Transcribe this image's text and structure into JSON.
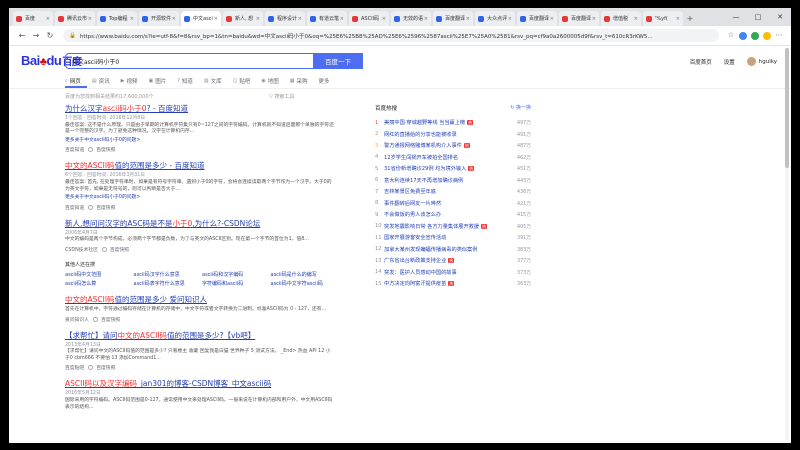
{
  "browser": {
    "tabs": [
      {
        "label": "百度",
        "icon": "red"
      },
      {
        "label": "腾讯云市",
        "icon": "red"
      },
      {
        "label": "Top编程",
        "icon": "blue"
      },
      {
        "label": "开源软件",
        "icon": "blue"
      },
      {
        "label": "中文asci",
        "icon": "blue",
        "active": true
      },
      {
        "label": "新人, 想",
        "icon": "red"
      },
      {
        "label": "程序设计",
        "icon": "blue"
      },
      {
        "label": "有道云笔",
        "icon": "blue"
      },
      {
        "label": "ASCII码",
        "icon": "red"
      },
      {
        "label": "无效的语",
        "icon": "blue"
      },
      {
        "label": "百度翻译",
        "icon": "blue"
      },
      {
        "label": "大众点评",
        "icon": "blue"
      },
      {
        "label": "百度翻译",
        "icon": "blue"
      },
      {
        "label": "百度翻译",
        "icon": "red"
      },
      {
        "label": "增值税",
        "icon": "red"
      },
      {
        "label": "'%yf(",
        "icon": "red"
      }
    ],
    "new_tab": "+",
    "win_min": "—",
    "win_max": "□",
    "win_close": "✕",
    "back": "←",
    "forward": "→",
    "reload": "↻",
    "url": "https://www.baidu.com/s?ie=utf-8&f=8&rsv_bp=1&tn=baidu&wd=中文ascii码小于0&oq=%25E6%25B8%25AD%25E6%2596%2587ascii%25E7%25A0%2581&rsv_pq=cf9a0a2600005d9f&rsv_t=610cR3rKW5..."
  },
  "baidu": {
    "logo_text": "Bai",
    "logo_paw": "♣",
    "logo_du": "du",
    "logo_cn": "百度",
    "query": "中文ascii码小于0",
    "search_button": "百度一下",
    "camera_icon": "◎",
    "header_links": [
      "百度首页",
      "设置"
    ],
    "username": "hgulky",
    "tabs": [
      {
        "icon": "⌕",
        "label": "网页"
      },
      {
        "icon": "▤",
        "label": "资讯"
      },
      {
        "icon": "▶",
        "label": "视频"
      },
      {
        "icon": "▣",
        "label": "图片"
      },
      {
        "icon": "?",
        "label": "知道"
      },
      {
        "icon": "▥",
        "label": "文库"
      },
      {
        "icon": "◫",
        "label": "贴吧"
      },
      {
        "icon": "◉",
        "label": "地图"
      },
      {
        "icon": "▦",
        "label": "采购"
      },
      {
        "icon": "",
        "label": "更多"
      }
    ],
    "result_count": "百度为您找到相关结果约17,600,000个",
    "search_tools": "▽ 搜索工具"
  },
  "results": [
    {
      "title_a": "为什么汉字",
      "title_em": "ascii码小于0",
      "title_b": "? - 百度知道",
      "date": "1个回答 · 回答时间: 2016年12月8日",
      "desc": "最佳答案: 这不是什么原理。只是由于早期的计算机字符集只有0~127之间的字符编码。计算机就不知道后面那个单独的字符还是一个完整的汉字。为了避免这种情况，汉字在计算机内存...",
      "more": "更多关于中文ascii码小于0的问题>",
      "src": "百度知道",
      "snap": "百度快照"
    },
    {
      "title_a": "",
      "title_em": "中文的ASCII码",
      "title_b": "值的范围是多少 - 百度知道",
      "date": "6个回答 · 回答时间: 2016年3月31日",
      "desc": "最佳答案: 首先, 在处理字符串时，如果是有符号字符串，遇到小于0的字符，会将会连续读取两个字节作为一个汉字。大于0的为英文字符，如果是无符号的，则可以判断是否大于...",
      "more": "更多关于中文ascii码小于0的问题>",
      "src": "百度知道",
      "snap": "百度快照"
    },
    {
      "title_a": "新人,想问问汉字的ASC码是不是",
      "title_em": "小于0",
      "title_b": ",为什么?-CSDN论坛",
      "date": "2006年4月7日",
      "desc": "中文的编码是两个字节构成，必须两个字节都是负数，为了与英文的ASCII区别。现在第一个字节的首位为1，值8...",
      "more": "",
      "src": "CSDN技术社区",
      "snap": "百度快照"
    }
  ],
  "related": {
    "title": "其他人还在搜",
    "items": [
      "ascii码中文范围",
      "ascii码汉字什么意思",
      "ascii码和汉字编码",
      "ascii码是什么的编写",
      "ascii码怎么算",
      "ascii码表字符什么意思",
      "字符编码和ascii码",
      "ascii码中文字符ascii码"
    ]
  },
  "results2": [
    {
      "title_a": "",
      "title_em": "中文的ASCII码",
      "title_b": "值的范围是多少 爱问知识人",
      "date": "",
      "desc": "首先在计算机中，字符通过编码存储在计算机的存储中，中文字符或者文字转换为二进制。标准ASCII码为 0 - 127，还有...",
      "src": "爱问知识人",
      "snap": "百度快照"
    },
    {
      "title_a": "【求帮忙】请问",
      "title_em": "中文的ASCII码",
      "title_b": "值的范围是多少?【vb吧】",
      "date": "2013年4月13日",
      "desc": "【求帮忙】请问中文的ASCII码值的范围是多少? 只看楼主 收藏 回复我是白猫 世界种子 5 测试方法。 _End> 热血 API 12 小于0 cbm666 不要怕 13 添加Command1...",
      "src": "百度贴吧",
      "snap": "百度快照"
    },
    {
      "title_a": "",
      "title_em": "ASCII码以及汉字编码",
      "title_b": "_jan301的博客-CSDN博客_中文ascii码",
      "date": "2016年5月12日",
      "desc": "国际采用的字符编码。ASCII码范围是0-127。通常使用中文来处理ASCII码。一般来说在计算机内部和用户外，中文用ASCII码表示的结构...",
      "src": "",
      "snap": ""
    }
  ],
  "hot": {
    "title": "百度热搜",
    "swap": "换一换",
    "items": [
      {
        "idx": "1",
        "text": "美丽中国·穿城越野等线 当当赢上榜",
        "tag": "热",
        "val": "497万"
      },
      {
        "idx": "2",
        "text": "网红的直播给的分享也能被收录",
        "tag": "",
        "val": "491万"
      },
      {
        "idx": "3",
        "text": "警方通报网络赌博某机构介入事件",
        "tag": "热",
        "val": "487万"
      },
      {
        "idx": "4",
        "text": "12岁学生闯祸开车被拍全国排名",
        "tag": "",
        "val": "462万"
      },
      {
        "idx": "5",
        "text": "31省份新增确诊29例 均为境外输入",
        "tag": "热",
        "val": "451万"
      },
      {
        "idx": "6",
        "text": "意大利连续17天不再增加确诊病例",
        "tag": "",
        "val": "443万"
      },
      {
        "idx": "7",
        "text": "吉林某景区免费至年底",
        "tag": "",
        "val": "436万"
      },
      {
        "idx": "8",
        "text": "事件翻转后网友一片哗然",
        "tag": "",
        "val": "421万"
      },
      {
        "idx": "9",
        "text": "不会做饭的男人该怎么办",
        "tag": "",
        "val": "415万"
      },
      {
        "idx": "10",
        "text": "突发地震影响日常 各方力量集体展开救援",
        "tag": "热",
        "val": "405万"
      },
      {
        "idx": "11",
        "text": "国家开展游客安全宣传活动",
        "tag": "",
        "val": "391万"
      },
      {
        "idx": "12",
        "text": "加拿大某州发现蝙蝠传播病毒的类似案例",
        "tag": "",
        "val": "383万"
      },
      {
        "idx": "13",
        "text": "广东省出台新政策支持企业",
        "tag": "热",
        "val": "377万"
      },
      {
        "idx": "14",
        "text": "突发：医护人员感动中国的故事",
        "tag": "",
        "val": "373万"
      },
      {
        "idx": "15",
        "text": "中方决定向阿富汗提供疫苗",
        "tag": "热",
        "val": "363万"
      }
    ]
  }
}
